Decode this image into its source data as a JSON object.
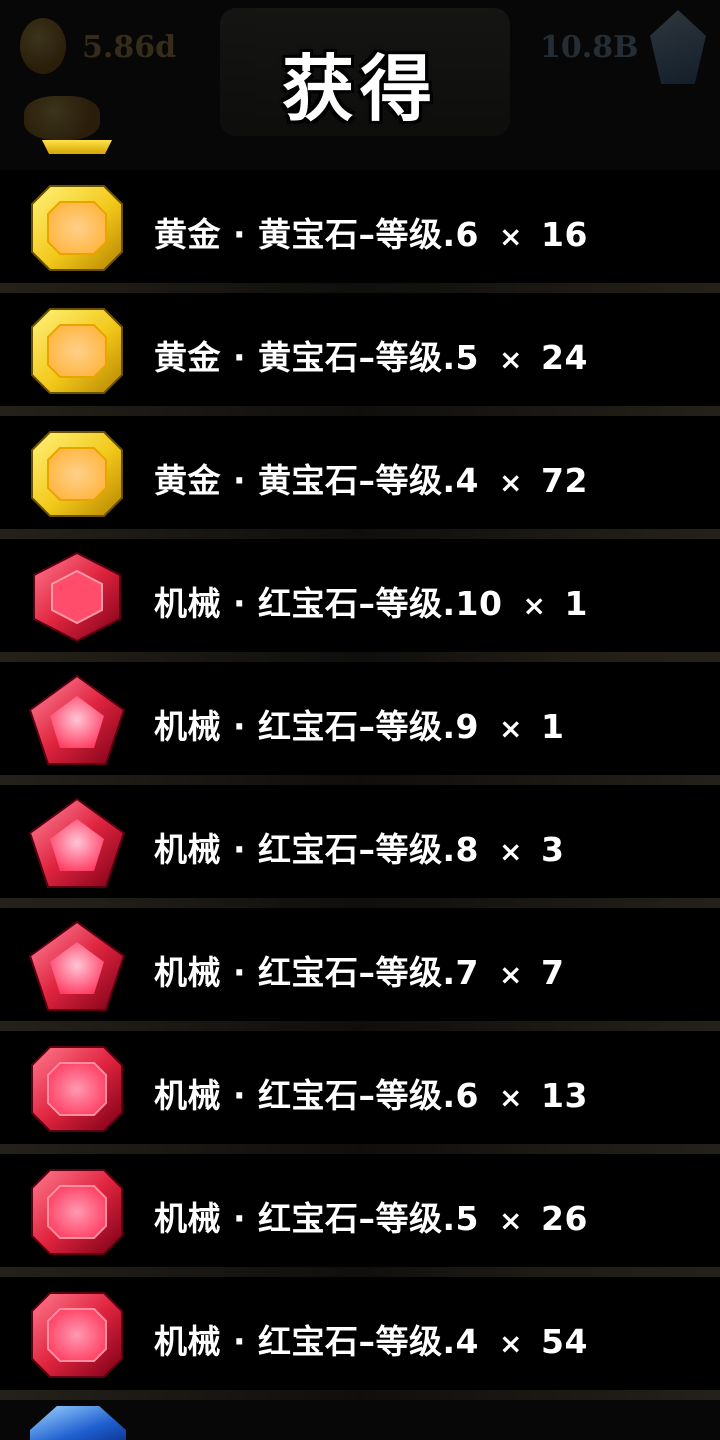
{
  "hud": {
    "gold_value": "5.86d",
    "gem_value": "10.8B"
  },
  "title": "获得",
  "colors": {
    "gold_gem": "#f2c81a",
    "ruby_gem": "#e0243f",
    "sapphire_gem": "#2a6ee8",
    "text": "#ffffff"
  },
  "items": [
    {
      "name": "黄金 · 黄宝石–等级.6",
      "multiplier": "×",
      "count": "16",
      "gem": "gold-square-icon"
    },
    {
      "name": "黄金 · 黄宝石–等级.5",
      "multiplier": "×",
      "count": "24",
      "gem": "gold-square-icon"
    },
    {
      "name": "黄金 · 黄宝石–等级.4",
      "multiplier": "×",
      "count": "72",
      "gem": "gold-square-icon"
    },
    {
      "name": "机械 · 红宝石–等级.10",
      "multiplier": "×",
      "count": "1",
      "gem": "ruby-hexagon-icon"
    },
    {
      "name": "机械 · 红宝石–等级.9",
      "multiplier": "×",
      "count": "1",
      "gem": "ruby-pentagon-icon"
    },
    {
      "name": "机械 · 红宝石–等级.8",
      "multiplier": "×",
      "count": "3",
      "gem": "ruby-pentagon-icon"
    },
    {
      "name": "机械 · 红宝石–等级.7",
      "multiplier": "×",
      "count": "7",
      "gem": "ruby-pentagon-icon"
    },
    {
      "name": "机械 · 红宝石–等级.6",
      "multiplier": "×",
      "count": "13",
      "gem": "ruby-square-icon"
    },
    {
      "name": "机械 · 红宝石–等级.5",
      "multiplier": "×",
      "count": "26",
      "gem": "ruby-square-icon"
    },
    {
      "name": "机械 · 红宝石–等级.4",
      "multiplier": "×",
      "count": "54",
      "gem": "ruby-square-icon"
    }
  ]
}
